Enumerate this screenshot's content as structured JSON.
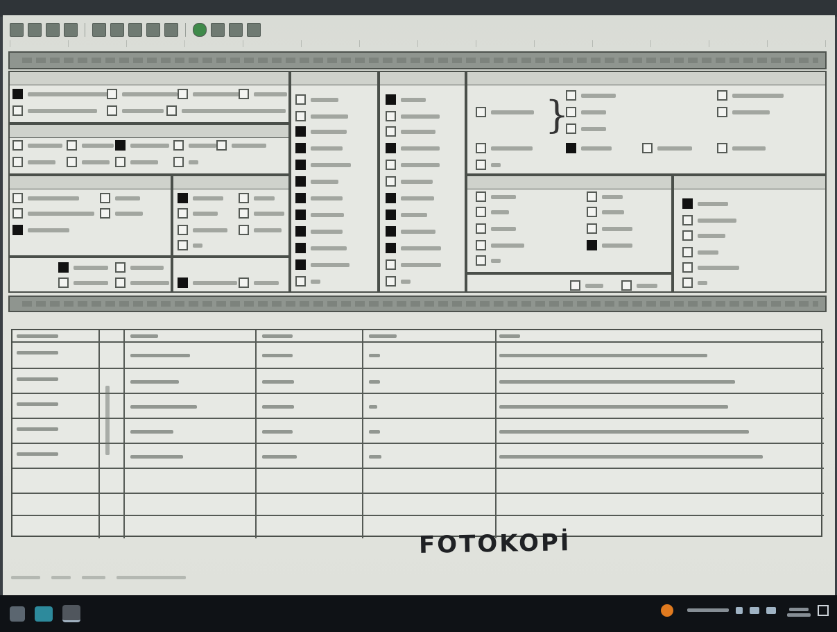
{
  "window": {
    "form_title": "",
    "program_section_title": "",
    "stamp_text": "FOTOKOPİ"
  },
  "toolbar": {
    "icons": [
      "save-icon",
      "print-icon",
      "copy-icon",
      "paste-icon",
      "undo-icon",
      "redo-icon",
      "zoom-icon",
      "find-icon",
      "settings-icon",
      "refresh-icon",
      "export-icon",
      "help-icon",
      "lock-icon"
    ]
  },
  "taskbar": {
    "weather_text": "",
    "clock_time": "",
    "clock_date": ""
  },
  "panels": {
    "p1": {
      "checked": [
        true,
        false,
        false,
        false,
        false,
        false,
        false
      ]
    },
    "p2": {
      "checked": [
        false,
        false,
        true,
        false,
        false,
        false,
        false,
        false,
        false
      ]
    },
    "p3": {
      "checked": [
        false,
        false,
        false,
        false,
        true
      ]
    },
    "p4": {
      "checked": [
        true,
        false,
        false,
        false,
        false,
        false,
        false
      ]
    },
    "p5": {
      "checked": [
        true,
        false,
        false,
        false,
        true,
        false
      ]
    },
    "p6": {
      "checked": [
        false,
        false,
        true,
        true,
        true,
        true,
        true,
        true,
        true,
        true,
        true,
        false
      ]
    },
    "p7": {
      "checked": [
        true,
        false,
        false,
        true,
        false,
        false,
        true,
        true,
        true,
        true,
        false,
        false
      ]
    },
    "p8": {
      "checked": [
        false,
        false,
        false,
        false,
        false,
        true,
        false,
        false,
        false,
        false,
        false
      ]
    },
    "p9": {
      "checked": [
        false,
        false,
        false,
        false,
        false,
        false,
        false,
        false,
        true,
        false
      ]
    },
    "p10": {
      "checked": [
        true,
        false,
        false,
        false,
        false,
        false
      ]
    },
    "p11": {
      "checked": [
        false,
        false
      ]
    }
  },
  "table": {
    "rows_filled": 5,
    "rows_empty": 3
  },
  "colors": {
    "screen": "#e2e4de",
    "checked": "#111111",
    "frame": "#4a4f4a",
    "taskbar": "#0f1216"
  }
}
